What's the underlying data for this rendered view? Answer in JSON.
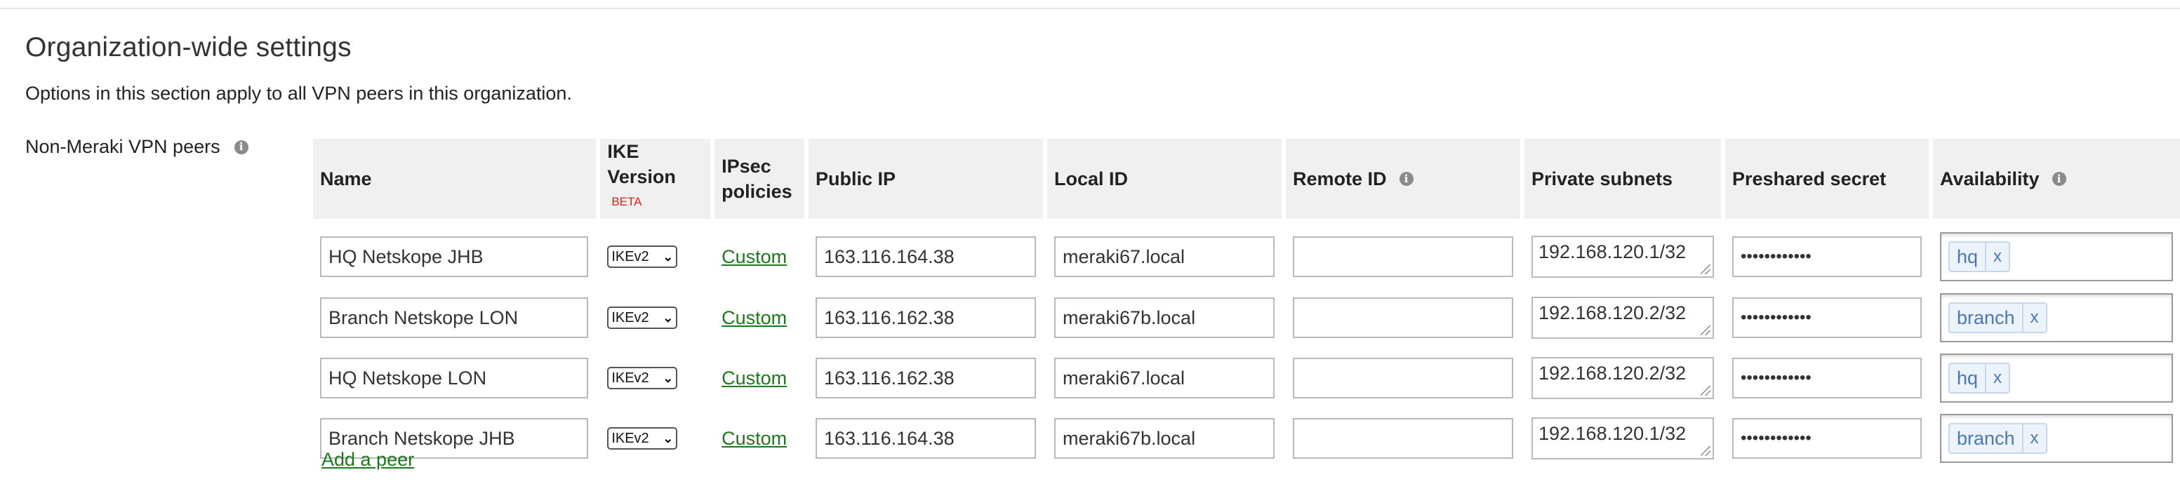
{
  "section": {
    "title": "Organization-wide settings",
    "description": "Options in this section apply to all VPN peers in this organization.",
    "peers_label": "Non-Meraki VPN peers"
  },
  "info_icon_glyph": "i",
  "headers": {
    "name": "Name",
    "ike_version": "IKE Version",
    "ike_beta": "BETA",
    "ipsec_policies": "IPsec policies",
    "public_ip": "Public IP",
    "local_id": "Local ID",
    "remote_id": "Remote ID",
    "private_subnets": "Private subnets",
    "preshared_secret": "Preshared secret",
    "availability": "Availability"
  },
  "peers": [
    {
      "name": "HQ Netskope JHB",
      "ike_version": "IKEv2",
      "ipsec": "Custom",
      "public_ip": "163.116.164.38",
      "local_id": "meraki67.local",
      "remote_id": "",
      "private_subnets": "192.168.120.1/32",
      "secret": "••••••••••••",
      "tag": "hq",
      "tag_remove": "x"
    },
    {
      "name": "Branch Netskope LON",
      "ike_version": "IKEv2",
      "ipsec": "Custom",
      "public_ip": "163.116.162.38",
      "local_id": "meraki67b.local",
      "remote_id": "",
      "private_subnets": "192.168.120.2/32",
      "secret": "••••••••••••",
      "tag": "branch",
      "tag_remove": "x"
    },
    {
      "name": "HQ Netskope LON",
      "ike_version": "IKEv2",
      "ipsec": "Custom",
      "public_ip": "163.116.162.38",
      "local_id": "meraki67.local",
      "remote_id": "",
      "private_subnets": "192.168.120.2/32",
      "secret": "••••••••••••",
      "tag": "hq",
      "tag_remove": "x"
    },
    {
      "name": "Branch Netskope JHB",
      "ike_version": "IKEv2",
      "ipsec": "Custom",
      "public_ip": "163.116.164.38",
      "local_id": "meraki67b.local",
      "remote_id": "",
      "private_subnets": "192.168.120.1/32",
      "secret": "••••••••••••",
      "tag": "branch",
      "tag_remove": "x"
    }
  ],
  "add_peer_label": "Add a peer",
  "colors": {
    "link": "#1b7a1b",
    "tag_text": "#4a78b8",
    "beta": "#d0271d",
    "header_bg": "#f0f0f0"
  }
}
